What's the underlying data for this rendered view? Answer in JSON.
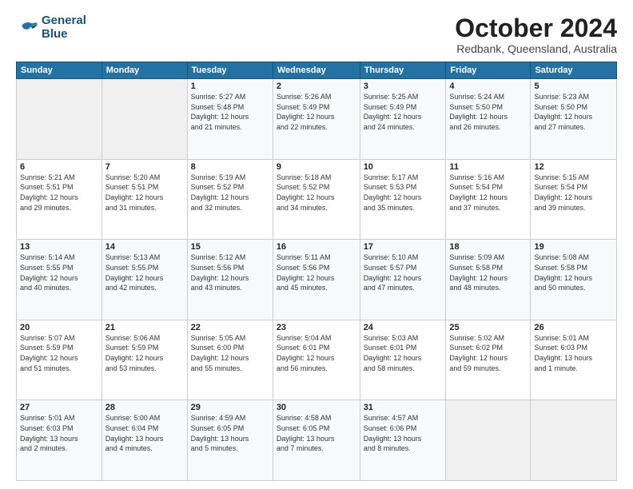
{
  "header": {
    "logo_line1": "General",
    "logo_line2": "Blue",
    "month": "October 2024",
    "location": "Redbank, Queensland, Australia"
  },
  "weekdays": [
    "Sunday",
    "Monday",
    "Tuesday",
    "Wednesday",
    "Thursday",
    "Friday",
    "Saturday"
  ],
  "weeks": [
    [
      {
        "day": "",
        "info": ""
      },
      {
        "day": "",
        "info": ""
      },
      {
        "day": "1",
        "info": "Sunrise: 5:27 AM\nSunset: 5:48 PM\nDaylight: 12 hours\nand 21 minutes."
      },
      {
        "day": "2",
        "info": "Sunrise: 5:26 AM\nSunset: 5:49 PM\nDaylight: 12 hours\nand 22 minutes."
      },
      {
        "day": "3",
        "info": "Sunrise: 5:25 AM\nSunset: 5:49 PM\nDaylight: 12 hours\nand 24 minutes."
      },
      {
        "day": "4",
        "info": "Sunrise: 5:24 AM\nSunset: 5:50 PM\nDaylight: 12 hours\nand 26 minutes."
      },
      {
        "day": "5",
        "info": "Sunrise: 5:23 AM\nSunset: 5:50 PM\nDaylight: 12 hours\nand 27 minutes."
      }
    ],
    [
      {
        "day": "6",
        "info": "Sunrise: 5:21 AM\nSunset: 5:51 PM\nDaylight: 12 hours\nand 29 minutes."
      },
      {
        "day": "7",
        "info": "Sunrise: 5:20 AM\nSunset: 5:51 PM\nDaylight: 12 hours\nand 31 minutes."
      },
      {
        "day": "8",
        "info": "Sunrise: 5:19 AM\nSunset: 5:52 PM\nDaylight: 12 hours\nand 32 minutes."
      },
      {
        "day": "9",
        "info": "Sunrise: 5:18 AM\nSunset: 5:52 PM\nDaylight: 12 hours\nand 34 minutes."
      },
      {
        "day": "10",
        "info": "Sunrise: 5:17 AM\nSunset: 5:53 PM\nDaylight: 12 hours\nand 35 minutes."
      },
      {
        "day": "11",
        "info": "Sunrise: 5:16 AM\nSunset: 5:54 PM\nDaylight: 12 hours\nand 37 minutes."
      },
      {
        "day": "12",
        "info": "Sunrise: 5:15 AM\nSunset: 5:54 PM\nDaylight: 12 hours\nand 39 minutes."
      }
    ],
    [
      {
        "day": "13",
        "info": "Sunrise: 5:14 AM\nSunset: 5:55 PM\nDaylight: 12 hours\nand 40 minutes."
      },
      {
        "day": "14",
        "info": "Sunrise: 5:13 AM\nSunset: 5:55 PM\nDaylight: 12 hours\nand 42 minutes."
      },
      {
        "day": "15",
        "info": "Sunrise: 5:12 AM\nSunset: 5:56 PM\nDaylight: 12 hours\nand 43 minutes."
      },
      {
        "day": "16",
        "info": "Sunrise: 5:11 AM\nSunset: 5:56 PM\nDaylight: 12 hours\nand 45 minutes."
      },
      {
        "day": "17",
        "info": "Sunrise: 5:10 AM\nSunset: 5:57 PM\nDaylight: 12 hours\nand 47 minutes."
      },
      {
        "day": "18",
        "info": "Sunrise: 5:09 AM\nSunset: 5:58 PM\nDaylight: 12 hours\nand 48 minutes."
      },
      {
        "day": "19",
        "info": "Sunrise: 5:08 AM\nSunset: 5:58 PM\nDaylight: 12 hours\nand 50 minutes."
      }
    ],
    [
      {
        "day": "20",
        "info": "Sunrise: 5:07 AM\nSunset: 5:59 PM\nDaylight: 12 hours\nand 51 minutes."
      },
      {
        "day": "21",
        "info": "Sunrise: 5:06 AM\nSunset: 5:59 PM\nDaylight: 12 hours\nand 53 minutes."
      },
      {
        "day": "22",
        "info": "Sunrise: 5:05 AM\nSunset: 6:00 PM\nDaylight: 12 hours\nand 55 minutes."
      },
      {
        "day": "23",
        "info": "Sunrise: 5:04 AM\nSunset: 6:01 PM\nDaylight: 12 hours\nand 56 minutes."
      },
      {
        "day": "24",
        "info": "Sunrise: 5:03 AM\nSunset: 6:01 PM\nDaylight: 12 hours\nand 58 minutes."
      },
      {
        "day": "25",
        "info": "Sunrise: 5:02 AM\nSunset: 6:02 PM\nDaylight: 12 hours\nand 59 minutes."
      },
      {
        "day": "26",
        "info": "Sunrise: 5:01 AM\nSunset: 6:03 PM\nDaylight: 13 hours\nand 1 minute."
      }
    ],
    [
      {
        "day": "27",
        "info": "Sunrise: 5:01 AM\nSunset: 6:03 PM\nDaylight: 13 hours\nand 2 minutes."
      },
      {
        "day": "28",
        "info": "Sunrise: 5:00 AM\nSunset: 6:04 PM\nDaylight: 13 hours\nand 4 minutes."
      },
      {
        "day": "29",
        "info": "Sunrise: 4:59 AM\nSunset: 6:05 PM\nDaylight: 13 hours\nand 5 minutes."
      },
      {
        "day": "30",
        "info": "Sunrise: 4:58 AM\nSunset: 6:05 PM\nDaylight: 13 hours\nand 7 minutes."
      },
      {
        "day": "31",
        "info": "Sunrise: 4:57 AM\nSunset: 6:06 PM\nDaylight: 13 hours\nand 8 minutes."
      },
      {
        "day": "",
        "info": ""
      },
      {
        "day": "",
        "info": ""
      }
    ]
  ]
}
